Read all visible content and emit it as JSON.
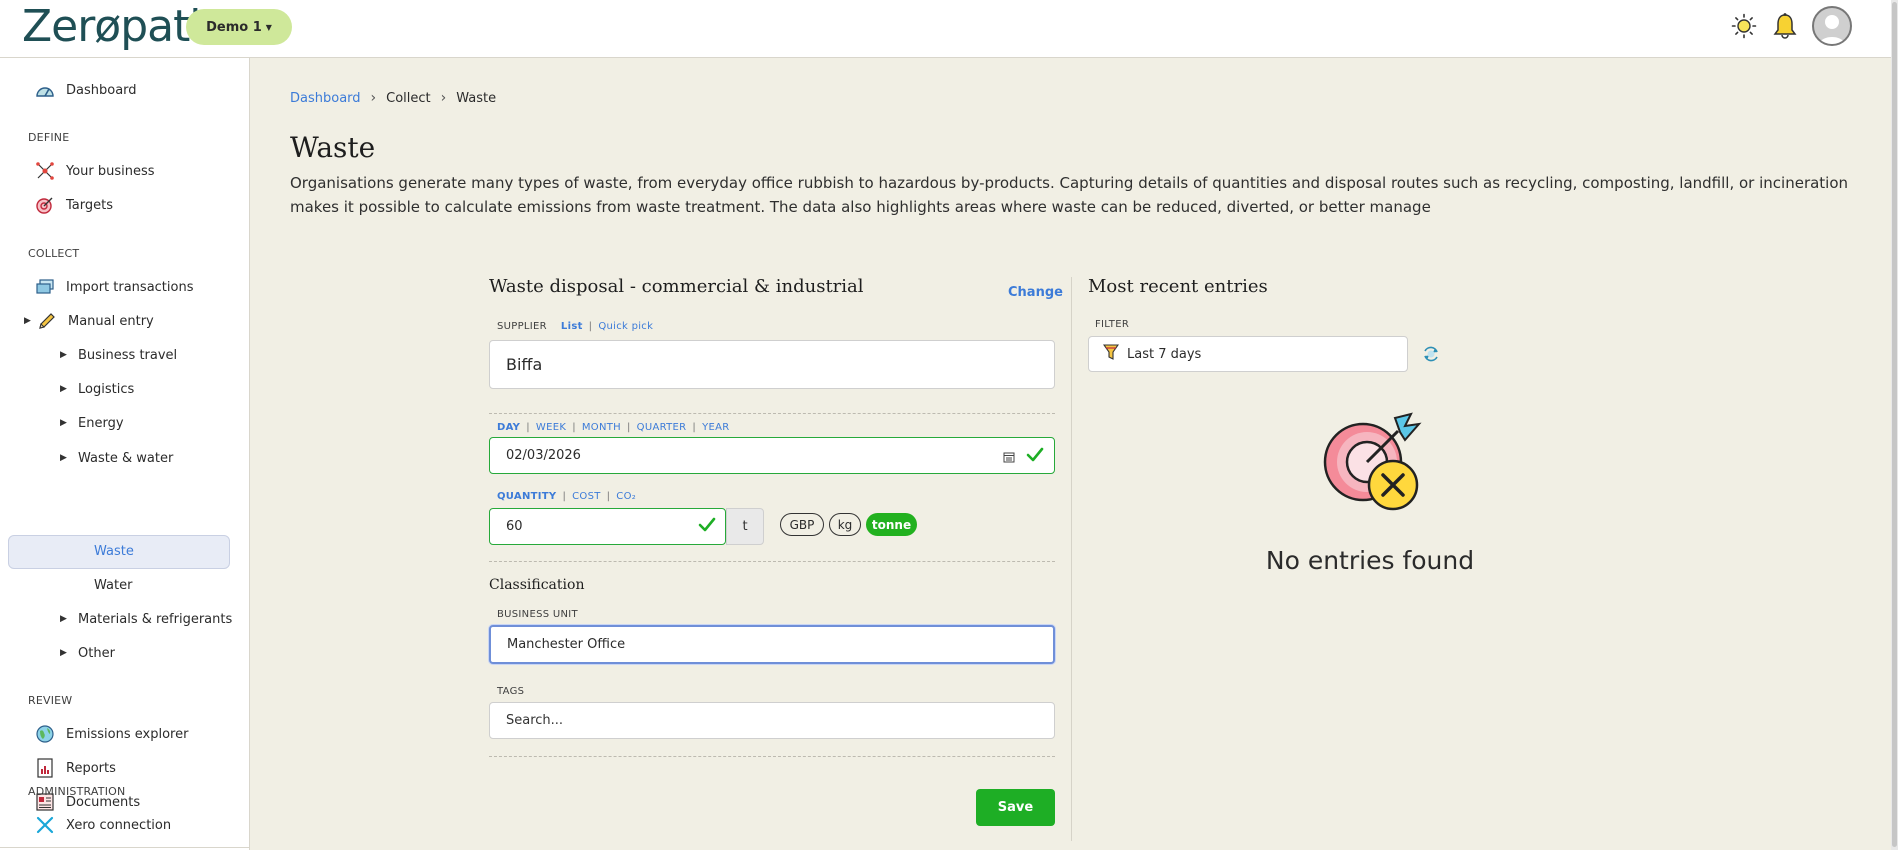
{
  "header": {
    "logo_text": "Zerøpath",
    "demo_label": "Demo 1",
    "icons": [
      "sun-icon",
      "bell-icon",
      "user-avatar"
    ]
  },
  "sidebar": {
    "dashboard": "Dashboard",
    "sections": {
      "define": "DEFINE",
      "collect": "COLLECT",
      "review": "REVIEW",
      "administration": "ADMINISTRATION"
    },
    "items": {
      "your_business": "Your business",
      "targets": "Targets",
      "import_transactions": "Import transactions",
      "manual_entry": "Manual entry",
      "business_travel": "Business travel",
      "logistics": "Logistics",
      "energy": "Energy",
      "waste_water": "Waste & water",
      "waste": "Waste",
      "water": "Water",
      "materials": "Materials & refrigerants",
      "other": "Other",
      "emissions_explorer": "Emissions explorer",
      "reports": "Reports",
      "documents": "Documents",
      "xero_connection": "Xero connection"
    }
  },
  "breadcrumb": {
    "dashboard": "Dashboard",
    "collect": "Collect",
    "current": "Waste"
  },
  "page": {
    "title": "Waste",
    "description": "Organisations generate many types of waste, from everyday office rubbish to hazardous by-products. Capturing details of quantities and disposal routes such as recycling, composting, landfill, or incineration makes it possible to calculate emissions from waste treatment. The data also highlights areas where waste can be reduced, diverted, or better manage"
  },
  "form": {
    "title": "Waste disposal - commercial & industrial",
    "change_label": "Change",
    "supplier": {
      "label": "SUPPLIER",
      "modes": [
        "List",
        "Quick pick"
      ],
      "value": "Biffa"
    },
    "period": {
      "options": [
        "DAY",
        "WEEK",
        "MONTH",
        "QUARTER",
        "YEAR"
      ],
      "selected": "DAY",
      "date_value": "02/03/2026"
    },
    "quantity": {
      "options": [
        "QUANTITY",
        "COST",
        "CO₂"
      ],
      "selected": "QUANTITY",
      "value": "60",
      "unit": "t",
      "unit_options": [
        "GBP",
        "kg",
        "tonne"
      ],
      "selected_unit": "tonne"
    },
    "classification_title": "Classification",
    "business_unit": {
      "label": "BUSINESS UNIT",
      "value": "Manchester Office"
    },
    "tags": {
      "label": "TAGS",
      "placeholder": "Search..."
    },
    "save_label": "Save"
  },
  "recent": {
    "title": "Most recent entries",
    "filter_label": "FILTER",
    "filter_value": "Last 7 days",
    "empty_text": "No entries found"
  },
  "colors": {
    "accent_blue": "#3c7bd8",
    "save_green": "#1eae25",
    "demo_green": "#cfe89a",
    "background": "#f1efe4"
  }
}
